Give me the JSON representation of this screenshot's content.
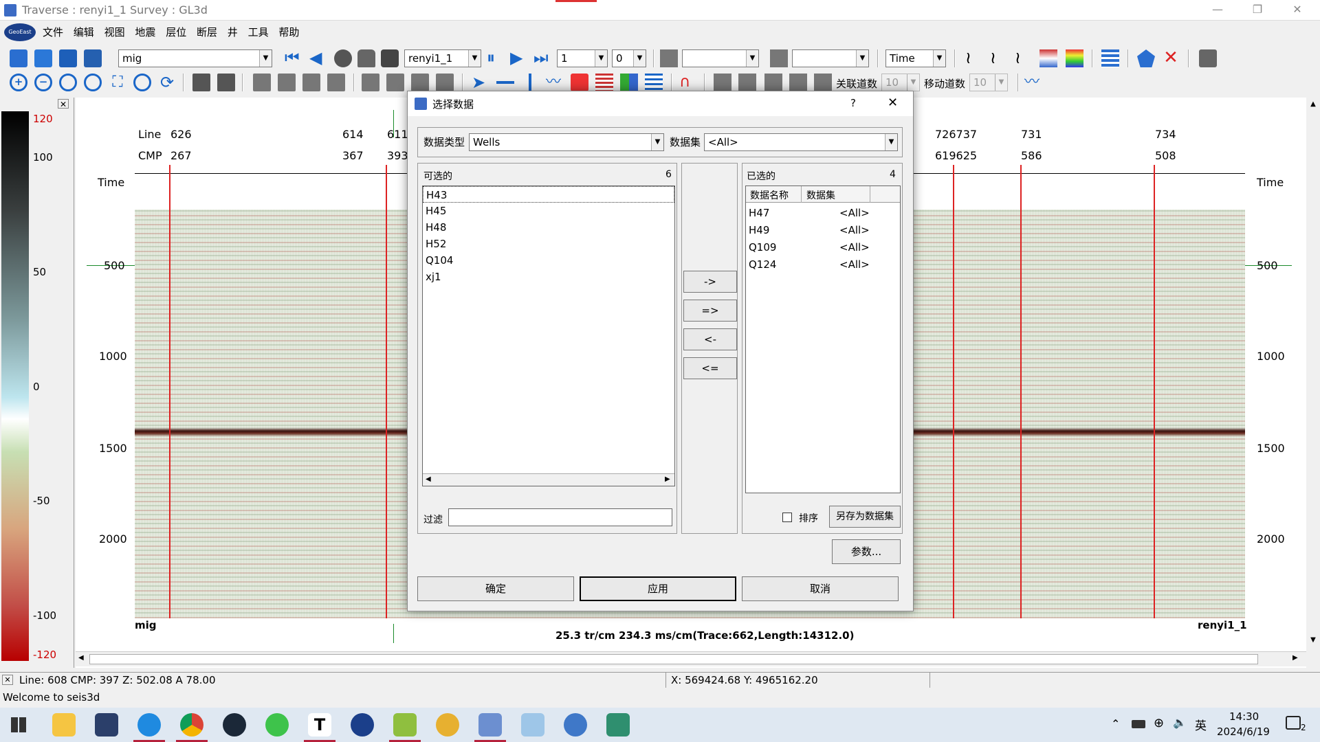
{
  "window": {
    "title": "Traverse : renyi1_1  Survey : GL3d",
    "min": "—",
    "max": "❐",
    "close": "✕",
    "logo": "GeoEast"
  },
  "menu": [
    "文件",
    "编辑",
    "视图",
    "地震",
    "层位",
    "断层",
    "井",
    "工具",
    "帮助"
  ],
  "toolbar1": {
    "data_combo": "mig",
    "line_combo": "renyi1_1",
    "step_combo": "1",
    "offset_combo": "0",
    "domain_combo": "Time"
  },
  "toolbar2": {
    "link_label": "关联道数",
    "link_value": "10",
    "move_label": "移动道数",
    "move_value": "10"
  },
  "colorbar": {
    "labels": [
      "120",
      "100",
      "50",
      "0",
      "-50",
      "-100",
      "-120"
    ]
  },
  "plot": {
    "line_label": "Line",
    "cmp_label": "CMP",
    "line_values_left": [
      "626",
      "614",
      "611"
    ],
    "cmp_values_left": [
      "267",
      "367",
      "393"
    ],
    "line_values_right": [
      "726737",
      "731",
      "734"
    ],
    "cmp_values_right": [
      "619625",
      "586",
      "508"
    ],
    "time_label": "Time",
    "time_ticks": [
      "500",
      "1000",
      "1500",
      "2000"
    ],
    "bottom_left": "mig",
    "bottom_right": "renyi1_1",
    "scale_text": "25.3 tr/cm 234.3 ms/cm(Trace:662,Length:14312.0)"
  },
  "status": {
    "cursor": "Line:  608  CMP:  397  Z:  502.08   A   78.00",
    "coords": "X:  569424.68   Y:  4965162.20",
    "welcome": "Welcome to seis3d"
  },
  "dialog": {
    "title": "选择数据",
    "help": "?",
    "close": "✕",
    "type_label": "数据类型",
    "type_value": "Wells",
    "set_label": "数据集",
    "set_value": "<All>",
    "avail_label": "可选的",
    "avail_count": "6",
    "available": [
      "H43",
      "H45",
      "H48",
      "H52",
      "Q104",
      "xj1"
    ],
    "selected_label": "已选的",
    "selected_count": "4",
    "col_name": "数据名称",
    "col_set": "数据集",
    "selected": [
      {
        "name": "H47",
        "set": "<All>"
      },
      {
        "name": "H49",
        "set": "<All>"
      },
      {
        "name": "Q109",
        "set": "<All>"
      },
      {
        "name": "Q124",
        "set": "<All>"
      }
    ],
    "move_buttons": [
      "->",
      "=>",
      "<-",
      "<="
    ],
    "filter_label": "过滤",
    "filter_value": "",
    "sort_label": "排序",
    "saveas_label": "另存为数据集",
    "params_label": "参数...",
    "ok_label": "确定",
    "apply_label": "应用",
    "cancel_label": "取消"
  },
  "tray": {
    "time": "14:30",
    "date": "2024/6/19",
    "ime": "英",
    "notif": "2"
  }
}
